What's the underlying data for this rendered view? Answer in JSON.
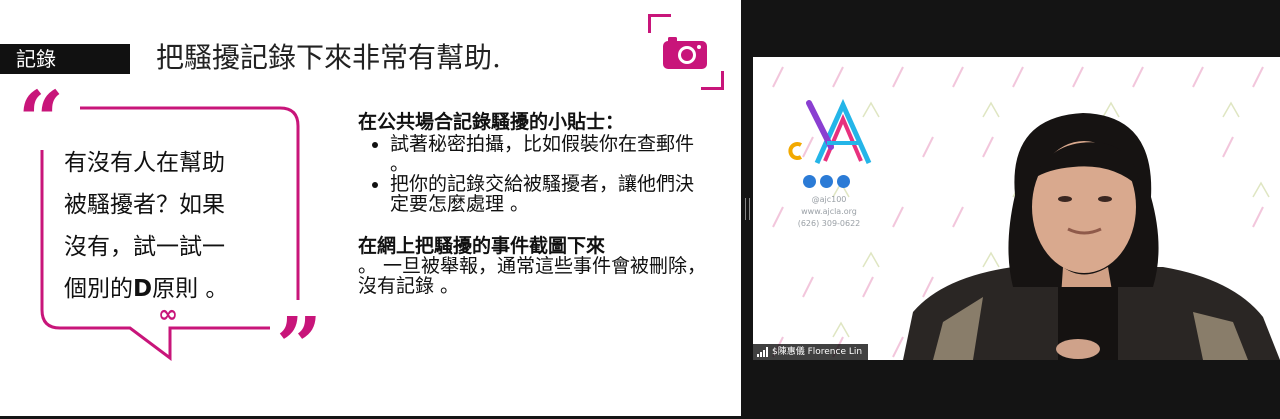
{
  "slide": {
    "tag": "記錄",
    "title": "把騷擾記錄下來非常有幫助.",
    "quote": {
      "lines": [
        "有沒有人在幫助",
        "被騷擾者？如果",
        "沒有，試一試一"
      ],
      "last_line_prefix": "個別的",
      "last_line_bold": "D",
      "last_line_suffix": "原則 。"
    },
    "tips_heading": "在公共場合記錄騷擾的小貼士：",
    "tips": [
      "試著秘密拍攝，比如假裝你在查郵件 。",
      "把你的記錄交給被騷擾者，讓他們決定要怎麼處理 。"
    ],
    "online_heading": "在網上把騷擾的事件截圖下來",
    "online_text": "。 一旦被舉報，通常這些事件會被刪除，沒有記錄 。",
    "accent_color": "#c8157a"
  },
  "video": {
    "participant_name": "$陳惠儀 Florence Lin",
    "org_handle": "@ajc100",
    "org_site": "www.ajcla.org",
    "org_phone": "(626) 309-0622",
    "icons": [
      "instagram-icon",
      "twitter-icon",
      "facebook-icon"
    ]
  }
}
